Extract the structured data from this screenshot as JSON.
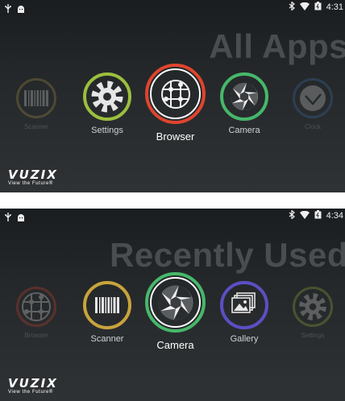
{
  "screens": [
    {
      "status": {
        "time": "4:31"
      },
      "title": "All Apps",
      "apps": [
        {
          "label": "Scanner",
          "icon": "barcode-icon",
          "ring_color": "#b39a4a"
        },
        {
          "label": "Settings",
          "icon": "gear-icon",
          "ring_color": "#9bbf3e"
        },
        {
          "label": "Browser",
          "icon": "globe-icon",
          "ring_color": "#e0442e",
          "selected": true
        },
        {
          "label": "Camera",
          "icon": "aperture-icon",
          "ring_color": "#46b86a"
        },
        {
          "label": "Clock",
          "icon": "clock-icon",
          "ring_color": "#3c78b8"
        }
      ],
      "brand": {
        "name": "VUZIX",
        "tagline": "View the Future®"
      }
    },
    {
      "status": {
        "time": "4:34"
      },
      "title": "Recently Used",
      "apps": [
        {
          "label": "Browser",
          "icon": "globe-icon",
          "ring_color": "#e0442e"
        },
        {
          "label": "Scanner",
          "icon": "barcode-icon",
          "ring_color": "#c9a33c"
        },
        {
          "label": "Camera",
          "icon": "aperture-icon",
          "ring_color": "#46b86a",
          "selected": true
        },
        {
          "label": "Gallery",
          "icon": "picture-icon",
          "ring_color": "#5b4fc4"
        },
        {
          "label": "Settings",
          "icon": "gear-icon",
          "ring_color": "#9bbf3e"
        }
      ],
      "brand": {
        "name": "VUZIX",
        "tagline": "View the Future®"
      }
    }
  ]
}
